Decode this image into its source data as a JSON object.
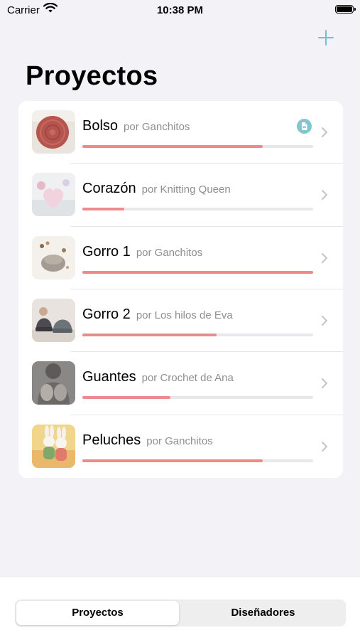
{
  "status_bar": {
    "carrier": "Carrier",
    "time": "10:38 PM"
  },
  "header": {
    "title": "Proyectos",
    "add_icon": "plus-icon"
  },
  "projects": [
    {
      "name": "Bolso",
      "designer": "por Ganchitos",
      "progress": 0.78,
      "has_document": true
    },
    {
      "name": "Corazón",
      "designer": "por Knitting Queen",
      "progress": 0.18,
      "has_document": false
    },
    {
      "name": "Gorro 1",
      "designer": "por Ganchitos",
      "progress": 1.0,
      "has_document": false
    },
    {
      "name": "Gorro 2",
      "designer": "por Los hilos de Eva",
      "progress": 0.58,
      "has_document": false
    },
    {
      "name": "Guantes",
      "designer": "por Crochet de Ana",
      "progress": 0.38,
      "has_document": false
    },
    {
      "name": "Peluches",
      "designer": "por Ganchitos",
      "progress": 0.78,
      "has_document": false
    }
  ],
  "tabs": {
    "projects_label": "Proyectos",
    "designers_label": "Diseñadores",
    "selected": "projects"
  },
  "colors": {
    "accent": "#6fc2cc",
    "progress": "#ef8a8a",
    "track": "#e8e8ea",
    "background": "#f2f2f7"
  }
}
